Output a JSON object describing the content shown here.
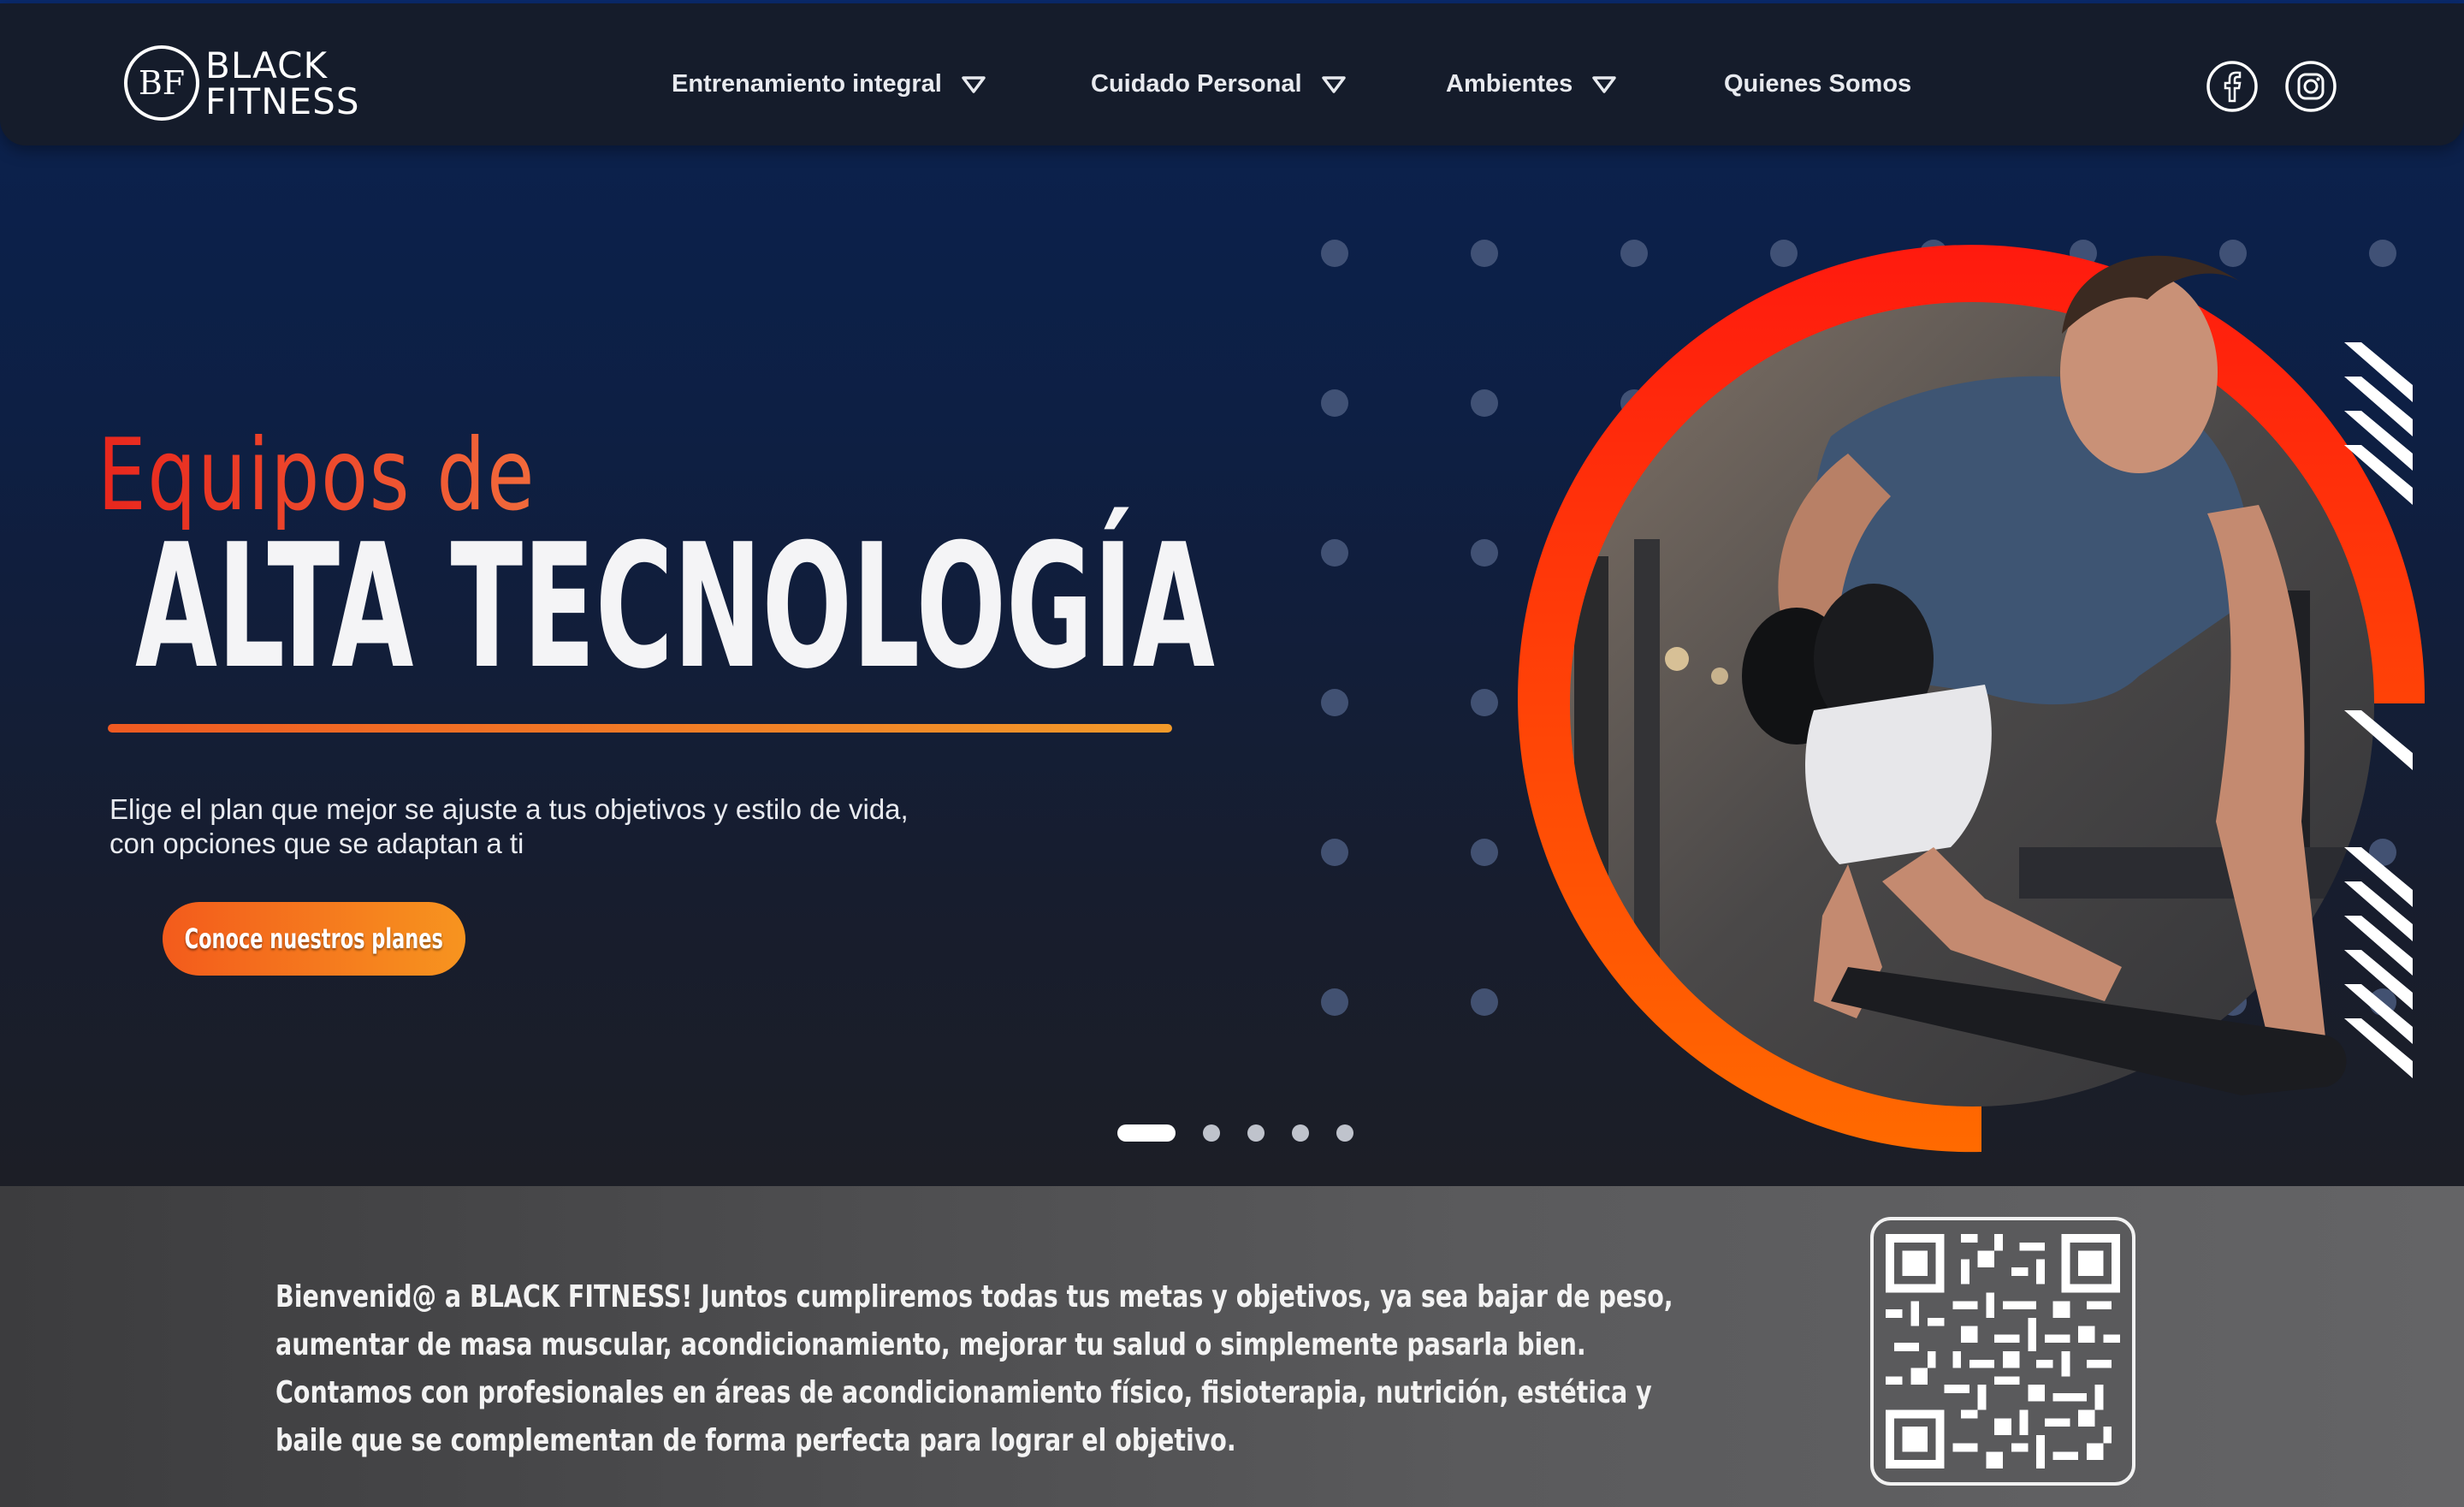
{
  "brand": {
    "monogram": "BF",
    "line1": "BLACK",
    "line2": "FITNESS"
  },
  "nav": {
    "items": [
      {
        "label": "Entrenamiento integral",
        "has_dropdown": true
      },
      {
        "label": "Cuidado Personal",
        "has_dropdown": true
      },
      {
        "label": "Ambientes",
        "has_dropdown": true
      },
      {
        "label": "Quienes Somos",
        "has_dropdown": false
      }
    ],
    "social": [
      {
        "icon": "facebook-icon"
      },
      {
        "icon": "instagram-icon"
      }
    ]
  },
  "hero": {
    "eyebrow": "Equipos de",
    "title": "ALTA TECNOLOGÍA",
    "subtitle_line1": "Elige el plan que mejor se ajuste a tus objetivos y estilo de vida,",
    "subtitle_line2": "con opciones que se adaptan a ti",
    "cta_label": "Conoce nuestros planes",
    "slides_total": 5,
    "slide_active": 1
  },
  "welcome": {
    "text": "Bienvenid@ a BLACK FITNESS! Juntos cumpliremos todas tus metas y objetivos, ya sea bajar de peso, aumentar de masa muscular, acondicionamiento, mejorar tu salud o simplemente pasarla bien. Contamos con profesionales en áreas de acondicionamiento físico, fisioterapia, nutrición, estética y baile que se complementan de forma perfecta para lograr el objetivo."
  },
  "colors": {
    "accent_red": "#e8261d",
    "accent_orange": "#f7941f",
    "navbar_bg": "#151c2b",
    "hero_bg_top": "#0b2250",
    "footer_band_bg": "#5a5a5c"
  }
}
